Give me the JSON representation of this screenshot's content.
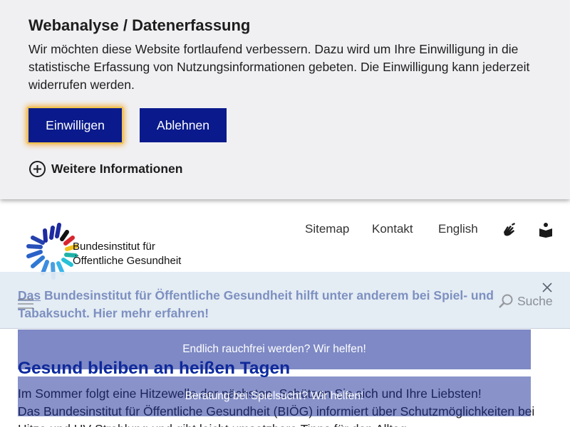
{
  "consent": {
    "title": "Webanalyse / Datenerfassung",
    "text": "Wir möchten diese Website fortlaufend verbessern. Dazu wird um Ihre Einwilligung in die statistische Erfassung von Nutzungsinformationen gebeten. Die Einwilligung kann jederzeit widerrufen werden.",
    "accept_label": "Einwilligen",
    "decline_label": "Ablehnen",
    "more_info_label": "Weitere Informationen"
  },
  "header": {
    "logo_line1": "Bundesinstitut für",
    "logo_line2": "Öffentliche Gesundheit",
    "nav": [
      "Sitemap",
      "Kontakt",
      "English"
    ],
    "icons": [
      "sign-language-icon",
      "easy-language-book-icon"
    ],
    "search_label": "Suche"
  },
  "toast": {
    "link_text": "Das",
    "text": " Bundesinstitut für Öffentliche Gesundheit hilft unter anderem bei Spiel- und Tabaksucht. Hier mehr erfahren!"
  },
  "promos": [
    "Endlich rauchfrei werden? Wir helfen!",
    "Beratung bei Spielsucht? Wir helfen!"
  ],
  "article": {
    "title": "Gesund bleiben an heißen Tagen",
    "p1": "Im Sommer folgt eine Hitzewelle der nächsten. Schützen Sie sich und Ihre Liebsten!",
    "p2": "Das Bundesinstitut für Öffentliche Gesundheit (BIÖG) informiert über Schutzmöglichkeiten bei Hitze und UV-Strahlung und gibt leicht umsetzbare Tipps für den Alltag."
  },
  "colors": {
    "primary": "#0a1a8c",
    "focus_ring": "#f3a42a",
    "title_blue": "#0a2aa0"
  }
}
